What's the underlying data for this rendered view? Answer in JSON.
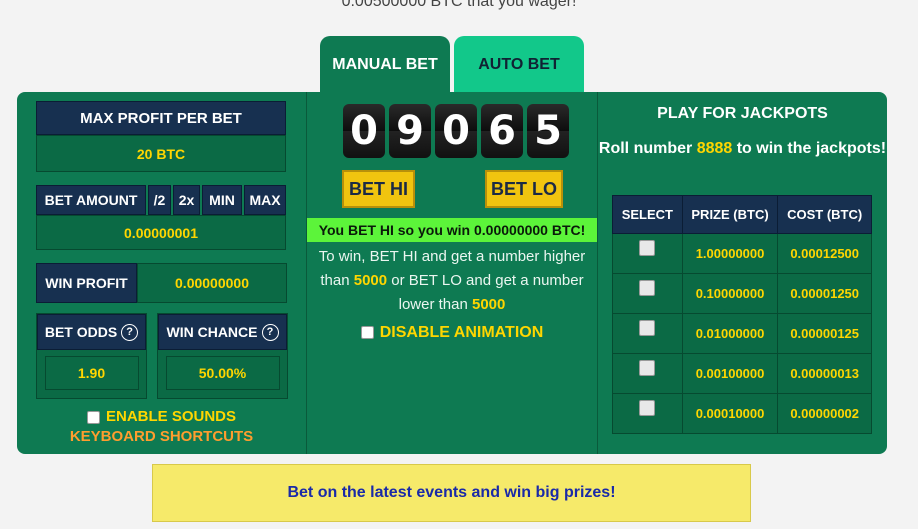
{
  "header": {
    "text": "0.00500000 BTC that you wager!"
  },
  "tabs": {
    "manual": "MANUAL BET",
    "auto": "AUTO BET"
  },
  "left": {
    "max_profit_label": "MAX PROFIT PER BET",
    "max_profit_value": "20 BTC",
    "bet_amount_label": "BET AMOUNT",
    "half_label": "/2",
    "double_label": "2x",
    "min_label": "MIN",
    "max_label": "MAX",
    "bet_amount_value": "0.00000001",
    "win_profit_label": "WIN PROFIT",
    "win_profit_value": "0.00000000",
    "bet_odds_label": "BET ODDS",
    "bet_odds_value": "1.90",
    "win_chance_label": "WIN CHANCE",
    "win_chance_value": "50.00%",
    "help_glyph": "?",
    "enable_sounds_label": "ENABLE SOUNDS",
    "keyboard_shortcuts_label": "KEYBOARD SHORTCUTS"
  },
  "center": {
    "digits": [
      "0",
      "9",
      "0",
      "6",
      "5"
    ],
    "bet_hi_label": "BET HI",
    "bet_lo_label": "BET LO",
    "result_text": "You BET HI so you win 0.00000000 BTC!",
    "info_part1": "To win, BET HI and get a number higher than ",
    "info_hi_number": "5000",
    "info_part2": " or BET LO and get a number lower than ",
    "info_lo_number": "5000",
    "disable_animation_label": "DISABLE ANIMATION"
  },
  "jackpot": {
    "title": "PLAY FOR JACKPOTS",
    "sub_part1": "Roll number ",
    "sub_number": "8888",
    "sub_part2": " to win the jackpots!",
    "columns": [
      "SELECT",
      "PRIZE (BTC)",
      "COST (BTC)"
    ],
    "rows": [
      {
        "prize": "1.00000000",
        "cost": "0.00012500"
      },
      {
        "prize": "0.10000000",
        "cost": "0.00001250"
      },
      {
        "prize": "0.01000000",
        "cost": "0.00000125"
      },
      {
        "prize": "0.00100000",
        "cost": "0.00000013"
      },
      {
        "prize": "0.00010000",
        "cost": "0.00000002"
      }
    ]
  },
  "banner": {
    "text": "Bet on the latest events and win big prizes!"
  },
  "colors": {
    "panel": "#0e7a52",
    "navy": "#173050",
    "gold": "#ffd600",
    "orange": "#ff9d2e",
    "result_green": "#5cf43a",
    "banner_yellow": "#f6ea6a"
  }
}
